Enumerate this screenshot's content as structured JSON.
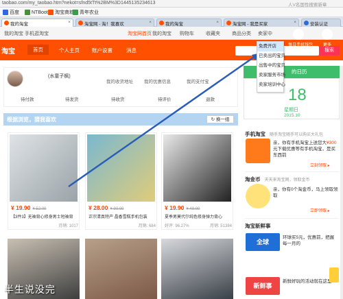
{
  "browser": {
    "url": "taobao.com/my_taobao.htm?nekot=sfnd5tTt%2BM%3D1445135234613",
    "ext_hint": "人V名国性搜索新章",
    "favorites": [
      {
        "label": "百度",
        "color": "#2f6bd8"
      },
      {
        "label": "NTBoot",
        "color": "#4a8f3a"
      },
      {
        "label": "淘宝商城",
        "color": "#ff5000"
      },
      {
        "label": "青年农业",
        "color": "#3a9d4a"
      }
    ],
    "tabs": [
      {
        "label": "我的淘宝"
      },
      {
        "label": "淘宝网 - 淘！我喜欢"
      },
      {
        "label": "我的淘宝"
      },
      {
        "label": "淘宝网 - 我是买家"
      },
      {
        "label": "安装认证"
      }
    ]
  },
  "topnav": {
    "left": [
      "我的淘宝",
      "手机逛淘宝"
    ],
    "links": [
      "淘宝网首页",
      "我的淘宝",
      "购物车",
      "收藏夹",
      "商品分类",
      "卖家中"
    ]
  },
  "header": {
    "logo": "淘宝",
    "nav": [
      "首页",
      "个人主页",
      "账户设置",
      "消息"
    ],
    "search_btn": "搜索",
    "circles": [
      {
        "label": "每日手机钱包"
      },
      {
        "label": "更多"
      }
    ]
  },
  "dropdown": {
    "items": [
      "免费开店",
      "已卖出的宝贝",
      "出售中的宝贝",
      "卖家服务市场",
      "卖家培训中心"
    ]
  },
  "profile": {
    "name": "(水童子枫)",
    "links": [
      "我的收货地址",
      "我的优惠信息",
      "我的支付宝"
    ],
    "stats": [
      "待付款",
      "待发货",
      "待收货",
      "待评价",
      "退款"
    ]
  },
  "recommend": {
    "title": "根据浏览，猜我喜欢",
    "refresh": "换一组"
  },
  "products": [
    {
      "price": "¥ 19.90",
      "old": "¥ 52.00",
      "title": "【3件3】无袖背心修身男士短袖背",
      "left": "",
      "sales": "月销: 1017",
      "colors": [
        "#dfe3e6",
        "#9aa3a8"
      ]
    },
    {
      "price": "¥ 28.00",
      "old": "¥ 90.00",
      "title": "正宗清真特产 晶香雪糕手机包装",
      "left": "",
      "sales": "月销: 684",
      "colors": [
        "#7ab8d0",
        "#e0cc7a"
      ]
    },
    {
      "price": "¥ 19.90",
      "old": "¥ 49.00",
      "title": "夏季男莫代尔纯色修身弹力背心",
      "left": "好评: 96.27%",
      "sales": "月销: 51384",
      "colors": [
        "#e9e9e9",
        "#222222"
      ]
    }
  ],
  "row2": [
    {
      "colors": [
        "#c9c0b3",
        "#3e3e3e"
      ]
    },
    {
      "colors": [
        "#b7a08a",
        "#7d5a48"
      ]
    },
    {
      "colors": [
        "#d7d9dc",
        "#3a4048"
      ]
    }
  ],
  "calendar": {
    "header": "的日历",
    "day": "18",
    "weekday": "星期日",
    "date": "2015.10"
  },
  "mobile": {
    "title": "手机淘宝",
    "sub": "随手淘宝随手可以购买大礼包",
    "text_a": "亲，你有",
    "text_b": "手机淘宝上送您大",
    "text_c": "¥300",
    "text_d": "元下载优惠等有手机淘宝，是买东西前",
    "more": "立刻领取 ▸"
  },
  "coin": {
    "title": "淘金币",
    "sub": "天天来淘宝网，领取金币",
    "text": "亲，你有0个淘金币，马上领取领取",
    "more": "立即领取 ▸"
  },
  "specials": {
    "title": "淘宝新鲜事",
    "items": [
      {
        "label": "全球",
        "text": "环球买5元，优惠前，把握每一月的",
        "color": "#1f6fd6"
      },
      {
        "label": "新鲜事",
        "text": "新鲜好玩的活动就在这里",
        "color": "#e44"
      }
    ]
  },
  "watermark": "半生说没完"
}
